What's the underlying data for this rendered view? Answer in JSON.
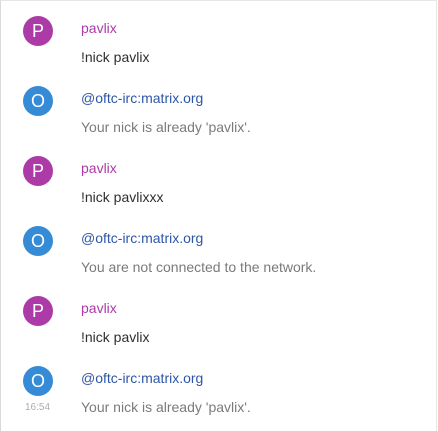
{
  "colors": {
    "pavlix_avatar": "#ac3ba8",
    "pavlix_name": "#ac3ba8",
    "bot_avatar": "#368bd6",
    "bot_name": "#2d56a8",
    "notice_text": "#7a7a7a",
    "message_text": "#2e2f32"
  },
  "timeline": {
    "events": [
      {
        "avatar_letter": "P",
        "sender": "pavlix",
        "body": "!nick pavlix"
      },
      {
        "avatar_letter": "O",
        "sender": "@oftc-irc:matrix.org",
        "body": "Your nick is already 'pavlix'."
      },
      {
        "avatar_letter": "P",
        "sender": "pavlix",
        "body": "!nick pavlixxx"
      },
      {
        "avatar_letter": "O",
        "sender": "@oftc-irc:matrix.org",
        "body": "You are not connected to the network."
      },
      {
        "avatar_letter": "P",
        "sender": "pavlix",
        "body": "!nick pavlix"
      },
      {
        "avatar_letter": "O",
        "sender": "@oftc-irc:matrix.org",
        "body": "Your nick is already 'pavlix'.",
        "timestamp": "16:54"
      }
    ]
  }
}
